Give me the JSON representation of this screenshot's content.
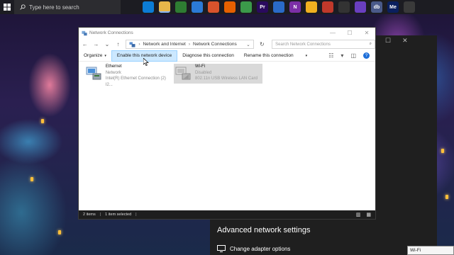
{
  "taskbar": {
    "search_placeholder": "Type here to search",
    "apps": [
      {
        "name": "task-view",
        "label": "",
        "color": "#1c1c22"
      },
      {
        "name": "edge",
        "label": "",
        "color": "#0c7cd5"
      },
      {
        "name": "file-explorer",
        "label": "",
        "color": "#e8b64a"
      },
      {
        "name": "app-green",
        "label": "",
        "color": "#2e7d32"
      },
      {
        "name": "mail",
        "label": "",
        "color": "#2b7ad6"
      },
      {
        "name": "app-orange",
        "label": "",
        "color": "#d9532c"
      },
      {
        "name": "firefox",
        "label": "",
        "color": "#e66000"
      },
      {
        "name": "chrome",
        "label": "",
        "color": "#3b9a4a"
      },
      {
        "name": "premiere",
        "label": "Pr",
        "color": "#2a0a5e"
      },
      {
        "name": "photos",
        "label": "",
        "color": "#2a6ac8"
      },
      {
        "name": "onenote",
        "label": "N",
        "color": "#7b2fa6"
      },
      {
        "name": "app-yellow",
        "label": "",
        "color": "#f0b020"
      },
      {
        "name": "app-red",
        "label": "",
        "color": "#c0392b"
      },
      {
        "name": "clapper",
        "label": "",
        "color": "#333333"
      },
      {
        "name": "app-purple",
        "label": "",
        "color": "#6a3fc0"
      },
      {
        "name": "db",
        "label": "db",
        "color": "#4a5a8a"
      },
      {
        "name": "media-encoder",
        "label": "Me",
        "color": "#0a1f5e"
      },
      {
        "name": "terminal",
        "label": "",
        "color": "#3a3a3a"
      }
    ]
  },
  "explorer": {
    "title": "Network Connections",
    "address": {
      "crumb1": "Network and Internet",
      "crumb2": "Network Connections"
    },
    "search_placeholder": "Search Network Connections",
    "commands": {
      "organize": "Organize",
      "enable": "Enable this network device",
      "diagnose": "Diagnose this connection",
      "rename": "Rename this connection"
    },
    "items": [
      {
        "name": "Ethernet",
        "status": "Network",
        "device": "Intel(R) Ethernet Connection (2) I2..."
      },
      {
        "name": "Wi-Fi",
        "status": "Disabled",
        "device": "802.11n USB Wireless LAN Card"
      }
    ],
    "status": {
      "count": "2 items",
      "selected": "1 item selected"
    }
  },
  "settings": {
    "heading": "Advanced network settings",
    "link": "Change adapter options"
  },
  "tooltip": "Wi-Fi"
}
